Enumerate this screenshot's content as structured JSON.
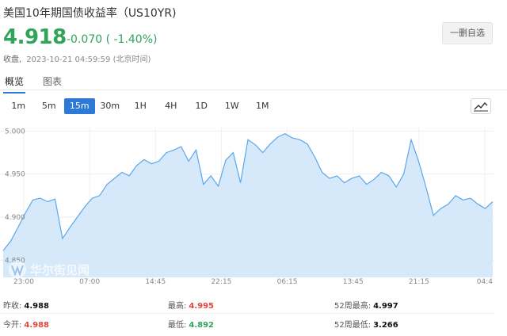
{
  "header": {
    "title": "美国10年期国债收益率（US10YR)",
    "price": "4.918",
    "change": "-0.070 ( -1.40%)",
    "status_label": "收盘,",
    "timestamp": "2023-10-21 04:59:59 (北京时间)",
    "watch_button": "一删自选",
    "color_down": "#2fa55a"
  },
  "tabs": [
    {
      "label": "概览",
      "active": true
    },
    {
      "label": "图表",
      "active": false
    }
  ],
  "periods": [
    {
      "label": "1m",
      "active": false
    },
    {
      "label": "5m",
      "active": false
    },
    {
      "label": "15m",
      "active": true
    },
    {
      "label": "30m",
      "active": false
    },
    {
      "label": "1H",
      "active": false
    },
    {
      "label": "4H",
      "active": false
    },
    {
      "label": "1D",
      "active": false
    },
    {
      "label": "1W",
      "active": false
    },
    {
      "label": "1M",
      "active": false
    }
  ],
  "chart_type_icon": "line-chart-icon",
  "watermark": "华尔街见闻",
  "chart_data": {
    "type": "area",
    "x": [
      "23:00",
      "07:00",
      "14:45",
      "22:15",
      "06:15",
      "13:45",
      "21:15",
      "04:4"
    ],
    "x_ticks": [
      "23:00",
      "07:00",
      "14:45",
      "22:15",
      "06:15",
      "13:45",
      "21:15",
      "04:4"
    ],
    "y_ticks": [
      "5.000",
      "4.950",
      "4.900",
      "4.850"
    ],
    "ylim": [
      4.83,
      5.005
    ],
    "grid": true,
    "line_color": "#5aa7ea",
    "fill_color": "#d6e9fa",
    "values": [
      4.861,
      4.872,
      4.888,
      4.905,
      4.92,
      4.922,
      4.918,
      4.921,
      4.875,
      4.888,
      4.9,
      4.912,
      4.922,
      4.925,
      4.938,
      4.945,
      4.952,
      4.948,
      4.96,
      4.967,
      4.962,
      4.965,
      4.975,
      4.978,
      4.982,
      4.965,
      4.978,
      4.938,
      4.948,
      4.936,
      4.966,
      4.975,
      4.94,
      4.99,
      4.984,
      4.975,
      4.985,
      4.993,
      4.997,
      4.992,
      4.99,
      4.985,
      4.97,
      4.952,
      4.945,
      4.948,
      4.94,
      4.945,
      4.948,
      4.938,
      4.944,
      4.952,
      4.948,
      4.935,
      4.95,
      4.99,
      4.965,
      4.935,
      4.902,
      4.91,
      4.915,
      4.925,
      4.92,
      4.922,
      4.915,
      4.91,
      4.918
    ]
  },
  "stats": {
    "prev_close_label": "昨收:",
    "prev_close": "4.988",
    "open_label": "今开:",
    "open": "4.988",
    "high_label": "最高:",
    "high": "4.995",
    "low_label": "最低:",
    "low": "4.892",
    "w52_high_label": "52周最高:",
    "w52_high": "4.997",
    "w52_low_label": "52周最低:",
    "w52_low": "3.266"
  }
}
